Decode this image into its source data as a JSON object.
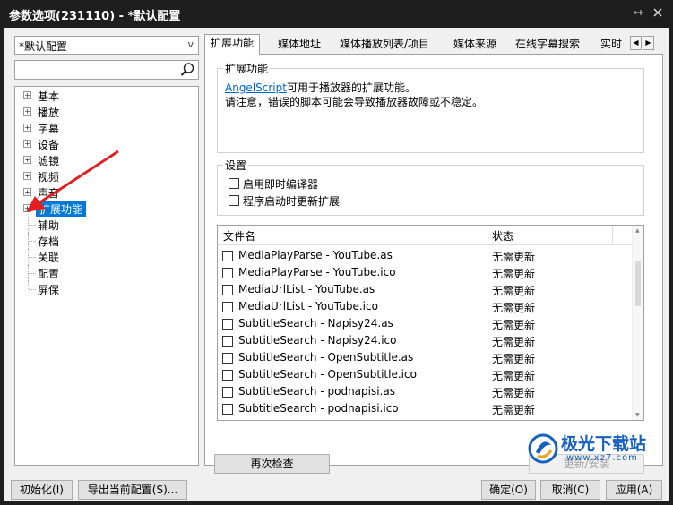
{
  "window": {
    "title": "参数选项(231110) - *默认配置",
    "pin_icon": "pin-icon",
    "close_icon": "close-icon"
  },
  "left": {
    "profile_value": "*默认配置",
    "search_placeholder": "",
    "tree": [
      {
        "label": "基本",
        "expandable": true
      },
      {
        "label": "播放",
        "expandable": true
      },
      {
        "label": "字幕",
        "expandable": true
      },
      {
        "label": "设备",
        "expandable": true
      },
      {
        "label": "滤镜",
        "expandable": true
      },
      {
        "label": "视频",
        "expandable": true
      },
      {
        "label": "声音",
        "expandable": true
      },
      {
        "label": "扩展功能",
        "expandable": true,
        "selected": true
      },
      {
        "label": "辅助",
        "expandable": false
      },
      {
        "label": "存档",
        "expandable": false
      },
      {
        "label": "关联",
        "expandable": false
      },
      {
        "label": "配置",
        "expandable": false
      },
      {
        "label": "屏保",
        "expandable": false
      }
    ]
  },
  "tabs": [
    "扩展功能",
    "媒体地址",
    "媒体播放列表/项目",
    "媒体来源",
    "在线字幕搜索",
    "实时"
  ],
  "extension": {
    "group_title": "扩展功能",
    "link_text": "AngelScript",
    "line1_rest": "可用于播放器的扩展功能。",
    "line2": "请注意，错误的脚本可能会导致播放器故障或不稳定。"
  },
  "settings": {
    "group_title": "设置",
    "options": [
      "启用即时编译器",
      "程序启动时更新扩展"
    ]
  },
  "list": {
    "columns": [
      "文件名",
      "状态"
    ],
    "rows": [
      {
        "name": "MediaPlayParse - YouTube.as",
        "status": "无需更新"
      },
      {
        "name": "MediaPlayParse - YouTube.ico",
        "status": "无需更新"
      },
      {
        "name": "MediaUrlList - YouTube.as",
        "status": "无需更新"
      },
      {
        "name": "MediaUrlList - YouTube.ico",
        "status": "无需更新"
      },
      {
        "name": "SubtitleSearch - Napisy24.as",
        "status": "无需更新"
      },
      {
        "name": "SubtitleSearch - Napisy24.ico",
        "status": "无需更新"
      },
      {
        "name": "SubtitleSearch - OpenSubtitle.as",
        "status": "无需更新"
      },
      {
        "name": "SubtitleSearch - OpenSubtitle.ico",
        "status": "无需更新"
      },
      {
        "name": "SubtitleSearch - podnapisi.as",
        "status": "无需更新"
      },
      {
        "name": "SubtitleSearch - podnapisi.ico",
        "status": "无需更新"
      }
    ]
  },
  "buttons": {
    "recheck": "再次检查",
    "update_install": "更新/安装",
    "init": "初始化(I)",
    "export": "导出当前配置(S)...",
    "ok": "确定(O)",
    "cancel": "取消(C)",
    "apply": "应用(A)"
  },
  "watermark": {
    "text": "极光下载站",
    "url": "www.xz7.com"
  },
  "colors": {
    "selection": "#0078d7",
    "link": "#0066cc",
    "annotation_arrow": "#e02020",
    "watermark": "#1560c0"
  }
}
